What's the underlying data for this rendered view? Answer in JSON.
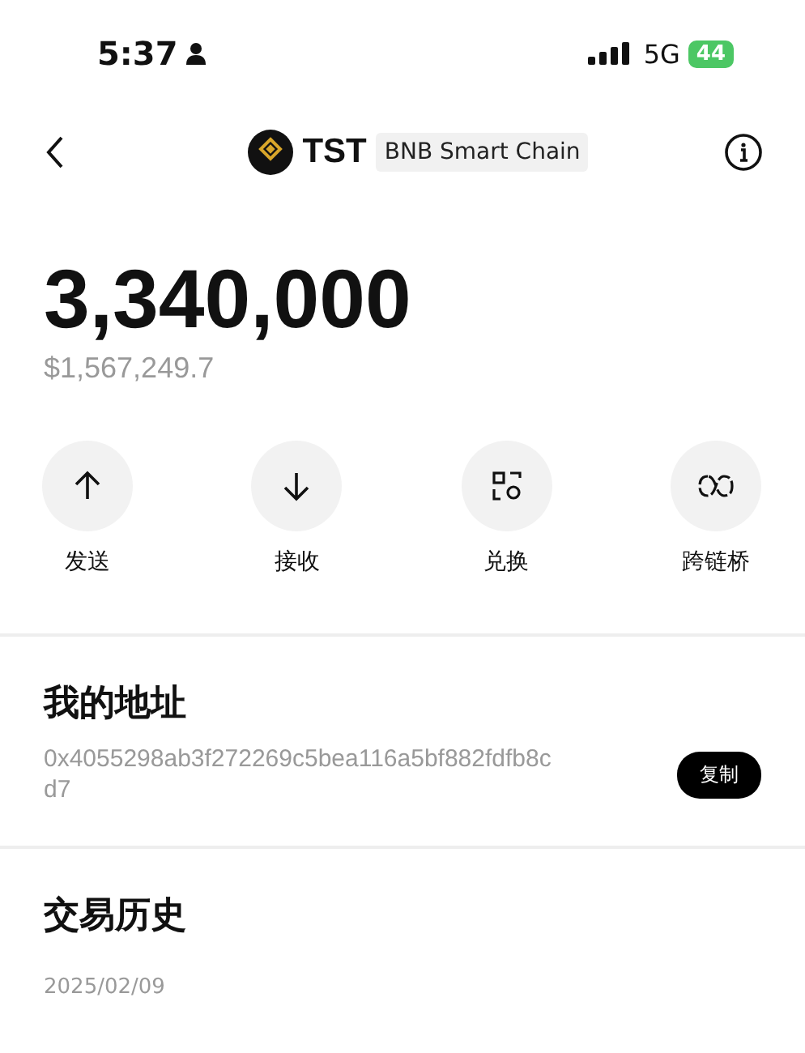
{
  "status_bar": {
    "time": "5:37",
    "network": "5G",
    "battery": "44"
  },
  "header": {
    "token": "TST",
    "chain": "BNB Smart Chain"
  },
  "balance": {
    "amount": "3,340,000",
    "usd": "$1,567,249.7"
  },
  "actions": [
    {
      "kind": "send",
      "label": "发送"
    },
    {
      "kind": "receive",
      "label": "接收"
    },
    {
      "kind": "swap",
      "label": "兑换"
    },
    {
      "kind": "bridge",
      "label": "跨链桥"
    }
  ],
  "address": {
    "title": "我的地址",
    "value": "0x4055298ab3f272269c5bea116a5bf882fdfb8cd7",
    "copy_button": "复制"
  },
  "history": {
    "title": "交易历史",
    "date": "2025/02/09"
  }
}
